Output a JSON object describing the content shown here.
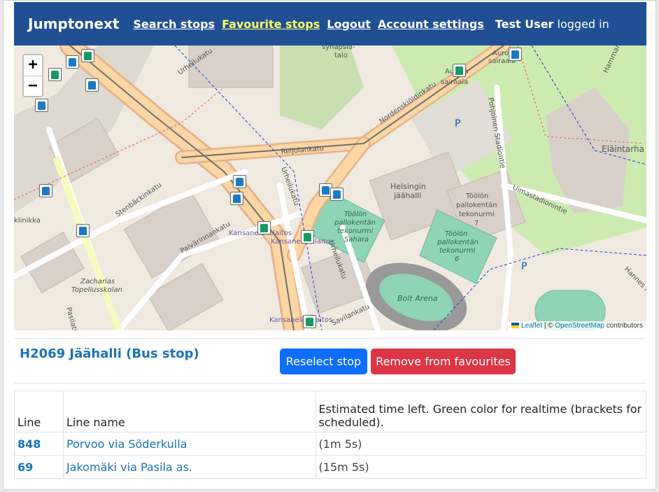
{
  "navbar": {
    "brand": "Jumptonext",
    "links": [
      "Search stops",
      "Favourite stops",
      "Logout",
      "Account settings"
    ],
    "user_name": "Test User",
    "user_suffix": "logged in"
  },
  "map": {
    "zoom_in": "+",
    "zoom_out": "−",
    "attribution": {
      "leaflet": "Leaflet",
      "separator": "| ©",
      "osm": "OpenStreetMap",
      "suffix": "contributors"
    },
    "labels": [
      "synapsia-talo",
      "Urheilukatu",
      "Nordenskiöldinkatu",
      "Reijolankatu",
      "Pohjoinen Stadiontie",
      "Eläintarha",
      "Uimastadionintie",
      "Stenbäckinkatu",
      "Urheilukatu",
      "Helsingin jäähalli",
      "Töölön pallokentän tekonurmi 7",
      "Töölön pallokentän tekonurmi Sahara",
      "Töölön pallokentän tekonurmi 6",
      "Kansaneläkelaitos",
      "Kansaneläkelaitos",
      "Paivärinnankatu",
      "Bolt Arena",
      "Zacharias Topeliusskolan",
      "Kansaneläkelaitos",
      "Savilankatu",
      "Urheilukatu",
      "Aurora sairaala",
      "Auror sairaala",
      "klinikka",
      "Pasilatie",
      "Hammar",
      "Hannes Kole"
    ]
  },
  "stop": {
    "title": "H2069 Jäähalli (Bus stop)",
    "reselect_label": "Reselect stop",
    "remove_label": "Remove from favourites"
  },
  "table": {
    "headers": [
      "Line",
      "Line name",
      "Estimated time left. Green color for realtime (brackets for scheduled)."
    ],
    "rows": [
      {
        "line": "848",
        "name": "Porvoo via Söderkulla",
        "time": "(1m 5s)"
      },
      {
        "line": "69",
        "name": "Jakomäki via Pasila as.",
        "time": "(15m 5s)"
      }
    ]
  },
  "colors": {
    "navbar": "#204f94",
    "active_link": "#ffff66",
    "primary": "#0d6efd",
    "danger": "#dc3545",
    "link": "#1a73b8"
  }
}
